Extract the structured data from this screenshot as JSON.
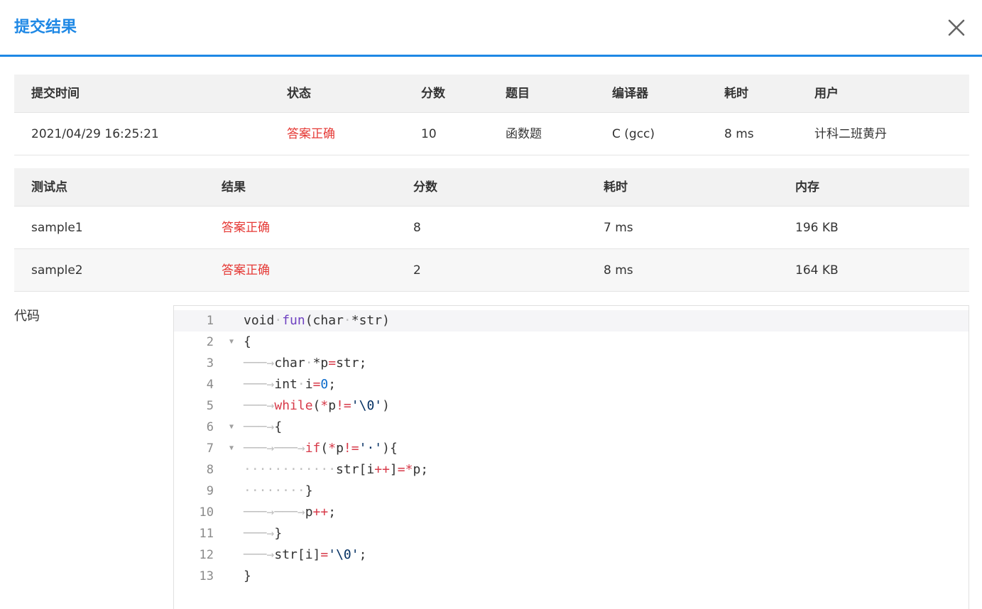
{
  "dialog": {
    "title": "提交结果",
    "close_icon": "close-icon"
  },
  "summary": {
    "headers": [
      "提交时间",
      "状态",
      "分数",
      "题目",
      "编译器",
      "耗时",
      "用户"
    ],
    "row": [
      "2021/04/29 16:25:21",
      "答案正确",
      "10",
      "函数题",
      "C (gcc)",
      "8 ms",
      "计科二班黄丹"
    ]
  },
  "tests": {
    "headers": [
      "测试点",
      "结果",
      "分数",
      "耗时",
      "内存"
    ],
    "rows": [
      [
        "sample1",
        "答案正确",
        "8",
        "7 ms",
        "196 KB"
      ],
      [
        "sample2",
        "答案正确",
        "2",
        "8 ms",
        "164 KB"
      ]
    ]
  },
  "code": {
    "label": "代码",
    "lines": [
      {
        "num": "1",
        "fold": "",
        "tokens": [
          [
            "void",
            "plain"
          ],
          [
            "·",
            "ws"
          ],
          [
            "fun",
            "fn"
          ],
          [
            "(char",
            "plain"
          ],
          [
            "·",
            "ws"
          ],
          [
            "*str)",
            "plain"
          ]
        ]
      },
      {
        "num": "2",
        "fold": "▼",
        "tokens": [
          [
            "{",
            "plain"
          ]
        ]
      },
      {
        "num": "3",
        "fold": "",
        "tokens": [
          [
            "───→",
            "ws"
          ],
          [
            "char",
            "plain"
          ],
          [
            "·",
            "ws"
          ],
          [
            "*p",
            "plain"
          ],
          [
            "=",
            "op"
          ],
          [
            "str;",
            "plain"
          ]
        ]
      },
      {
        "num": "4",
        "fold": "",
        "tokens": [
          [
            "───→",
            "ws"
          ],
          [
            "int",
            "plain"
          ],
          [
            "·",
            "ws"
          ],
          [
            "i",
            "plain"
          ],
          [
            "=",
            "op"
          ],
          [
            "0",
            "num"
          ],
          [
            ";",
            "plain"
          ]
        ]
      },
      {
        "num": "5",
        "fold": "",
        "tokens": [
          [
            "───→",
            "ws"
          ],
          [
            "while",
            "kw"
          ],
          [
            "(",
            "plain"
          ],
          [
            "*",
            "op"
          ],
          [
            "p",
            "plain"
          ],
          [
            "!=",
            "op"
          ],
          [
            "'\\0'",
            "str"
          ],
          [
            ")",
            "plain"
          ]
        ]
      },
      {
        "num": "6",
        "fold": "▼",
        "tokens": [
          [
            "───→",
            "ws"
          ],
          [
            "{",
            "plain"
          ]
        ]
      },
      {
        "num": "7",
        "fold": "▼",
        "tokens": [
          [
            "───→───→",
            "ws"
          ],
          [
            "if",
            "kw"
          ],
          [
            "(",
            "plain"
          ],
          [
            "*",
            "op"
          ],
          [
            "p",
            "plain"
          ],
          [
            "!=",
            "op"
          ],
          [
            "'·'",
            "str"
          ],
          [
            "){",
            "plain"
          ]
        ]
      },
      {
        "num": "8",
        "fold": "",
        "tokens": [
          [
            "············",
            "ws"
          ],
          [
            "str[i",
            "plain"
          ],
          [
            "++",
            "op"
          ],
          [
            "]",
            "plain"
          ],
          [
            "=*",
            "op"
          ],
          [
            "p;",
            "plain"
          ]
        ]
      },
      {
        "num": "9",
        "fold": "",
        "tokens": [
          [
            "········",
            "ws"
          ],
          [
            "}",
            "plain"
          ]
        ]
      },
      {
        "num": "10",
        "fold": "",
        "tokens": [
          [
            "───→───→",
            "ws"
          ],
          [
            "p",
            "plain"
          ],
          [
            "++",
            "op"
          ],
          [
            ";",
            "plain"
          ]
        ]
      },
      {
        "num": "11",
        "fold": "",
        "tokens": [
          [
            "───→",
            "ws"
          ],
          [
            "}",
            "plain"
          ]
        ]
      },
      {
        "num": "12",
        "fold": "",
        "tokens": [
          [
            "───→",
            "ws"
          ],
          [
            "str[i]",
            "plain"
          ],
          [
            "=",
            "op"
          ],
          [
            "'\\0'",
            "str"
          ],
          [
            ";",
            "plain"
          ]
        ]
      },
      {
        "num": "13",
        "fold": "",
        "tokens": [
          [
            "}",
            "plain"
          ]
        ]
      }
    ]
  },
  "colors": {
    "accent": "#1e88e5",
    "status_ok": "#e53935",
    "header_bg": "#f2f2f2"
  }
}
